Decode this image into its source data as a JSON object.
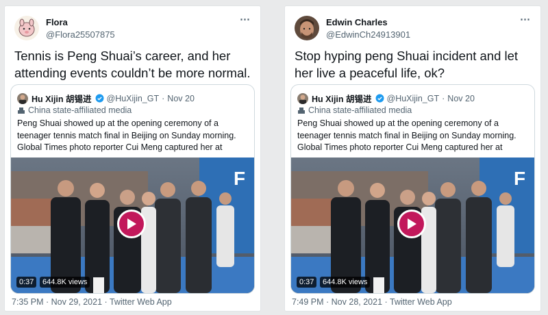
{
  "tweets": [
    {
      "display_name": "Flora",
      "handle": "@Flora25507875",
      "text": "Tennis is Peng Shuai’s career, and her attending events couldn’t be more normal.",
      "more_icon": "⋯",
      "quote": {
        "name": "Hu Xijin 胡锡进",
        "handle": "@HuXijin_GT",
        "separator": "·",
        "date": "Nov 20",
        "label": "China state-affiliated media",
        "text": "Peng Shuai showed up at the opening ceremony of a teenager tennis match final in Beijing on Sunday morning. Global Times photo reporter Cui Meng captured her at scene.",
        "video_duration": "0:37",
        "video_views": "644.8K views"
      },
      "footer": "7:35 PM · Nov 29, 2021 · Twitter Web App"
    },
    {
      "display_name": "Edwin Charles",
      "handle": "@EdwinCh24913901",
      "text": "Stop hyping peng Shuai incident and let her live a peaceful life, ok?",
      "more_icon": "⋯",
      "quote": {
        "name": "Hu Xijin 胡锡进",
        "handle": "@HuXijin_GT",
        "separator": "·",
        "date": "Nov 20",
        "label": "China state-affiliated media",
        "text": "Peng Shuai showed up at the opening ceremony of a teenager tennis match final in Beijing on Sunday morning. Global Times photo reporter Cui Meng captured her at scene.",
        "video_duration": "0:37",
        "video_views": "644.8K views"
      },
      "footer": "7:49 PM · Nov 28, 2021 · Twitter Web App"
    }
  ],
  "colors": {
    "verified": "#1d9bf0",
    "play_button": "#c2185b",
    "secondary_text": "#536471"
  },
  "icons": {
    "more": "more-icon",
    "verified": "verified-badge-icon",
    "state_media": "podium-icon",
    "play": "play-icon"
  }
}
